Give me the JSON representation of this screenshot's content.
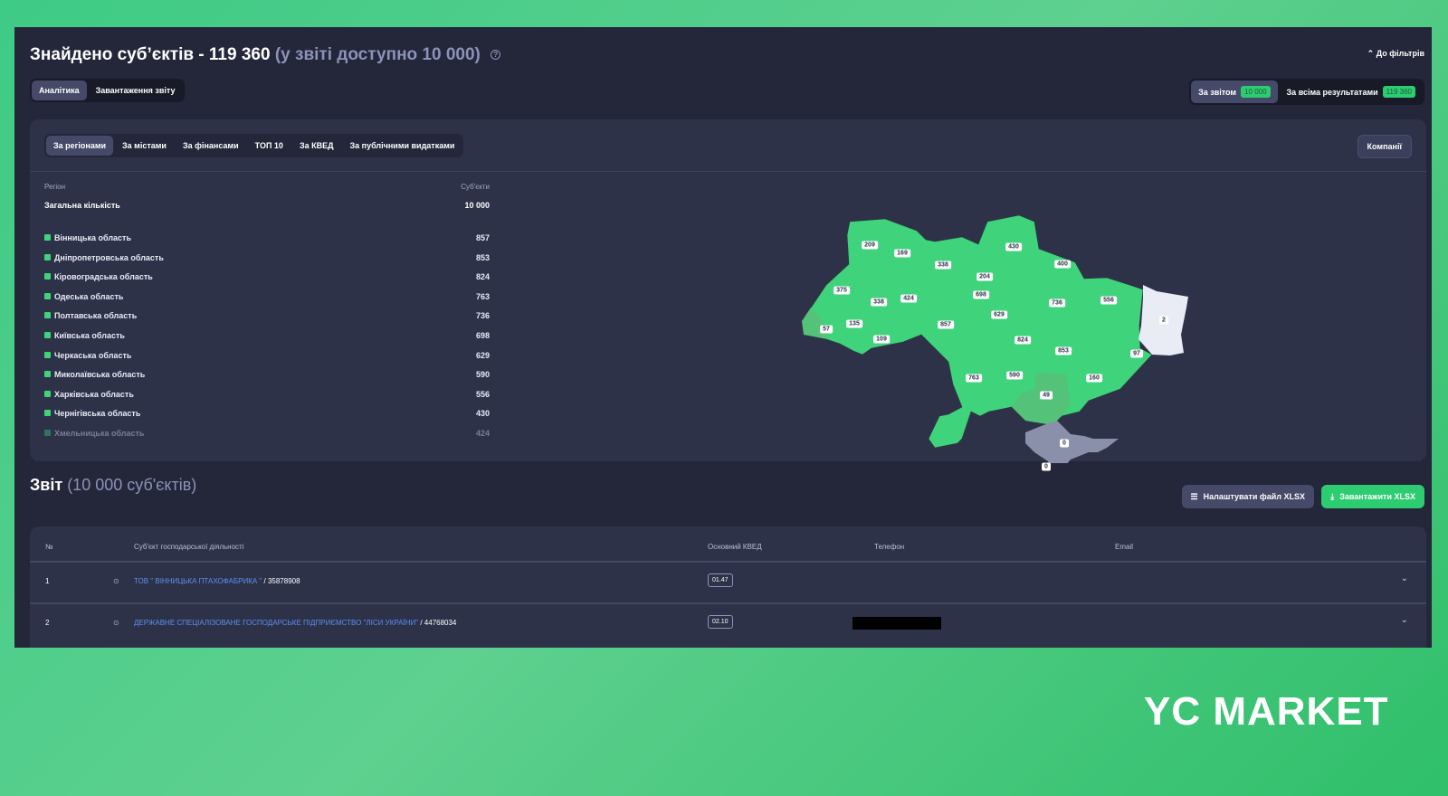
{
  "header": {
    "title_main": "Знайдено суб’єктів - 119 360",
    "title_muted": "(у звіті доступно 10 000)",
    "help_icon": "?",
    "to_filters": "До фільтрів"
  },
  "view_tabs": [
    {
      "label": "Аналітика",
      "active": true
    },
    {
      "label": "Завантаження звіту",
      "active": false
    }
  ],
  "scope_tabs": [
    {
      "label": "За звітом",
      "count": "10 000",
      "active": true
    },
    {
      "label": "За всіма результатами",
      "count": "119 360",
      "active": false
    }
  ],
  "analytics": {
    "tabs": [
      "За регіонами",
      "За містами",
      "За фінансами",
      "ТОП 10",
      "За КВЕД",
      "За публічними видатками"
    ],
    "companies_button": "Компанії",
    "col_region": "Регіон",
    "col_subjects": "Суб'єкти",
    "total_label": "Загальна кількість",
    "total_value": "10 000",
    "regions": [
      {
        "name": "Вінницька область",
        "value": "857"
      },
      {
        "name": "Дніпропетровська область",
        "value": "853"
      },
      {
        "name": "Кіровоградська область",
        "value": "824"
      },
      {
        "name": "Одеська область",
        "value": "763"
      },
      {
        "name": "Полтавська область",
        "value": "736"
      },
      {
        "name": "Київська область",
        "value": "698"
      },
      {
        "name": "Черкаська область",
        "value": "629"
      },
      {
        "name": "Миколаївська область",
        "value": "590"
      },
      {
        "name": "Харківська область",
        "value": "556"
      },
      {
        "name": "Чернігівська область",
        "value": "430"
      },
      {
        "name": "Хмельницька область",
        "value": "424"
      }
    ],
    "map_labels": [
      "209",
      "169",
      "338",
      "430",
      "400",
      "204",
      "375",
      "338",
      "424",
      "698",
      "736",
      "556",
      "2",
      "57",
      "135",
      "857",
      "629",
      "109",
      "824",
      "853",
      "97",
      "763",
      "590",
      "160",
      "49",
      "0",
      "0"
    ],
    "colors": {
      "region": "#3fd37b",
      "low": "#55c27a",
      "none": "#e9ecf5",
      "occupied": "#8a90aa"
    }
  },
  "report": {
    "title": "Звіт",
    "count": "(10 000 суб'єктів)",
    "configure_button": "Налаштувати файл XLSX",
    "download_button": "Завантажити XLSX",
    "columns": [
      "№",
      "Суб'єкт господарської діяльності",
      "Основний КВЕД",
      "Телефон",
      "Email"
    ],
    "rows": [
      {
        "num": "1",
        "name": "ТОВ \" ВІННИЦЬКА ПТАХОФАБРИКА \"",
        "code": "/ 35878908",
        "kved": "01.47"
      },
      {
        "num": "2",
        "name": "ДЕРЖАВНЕ СПЕЦІАЛІЗОВАНЕ ГОСПОДАРСЬКЕ ПІДПРИЄМСТВО \"ЛІСИ УКРАЇНИ\"",
        "code": "/ 44768034",
        "kved": "02.10"
      }
    ]
  },
  "brand": {
    "logo": "YC MARKET"
  }
}
